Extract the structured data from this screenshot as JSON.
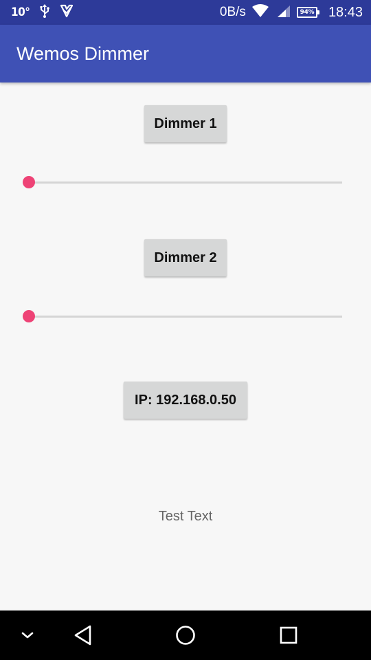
{
  "status_bar": {
    "temperature": "10°",
    "speed": "0B/s",
    "battery": "94%",
    "time": "18:43",
    "icons": [
      "usb-icon",
      "app-notification-icon",
      "wifi-icon",
      "signal-icon",
      "battery-icon"
    ]
  },
  "app_bar": {
    "title": "Wemos Dimmer",
    "color": "#3F51B5"
  },
  "main": {
    "dimmer1_label": "Dimmer 1",
    "slider1_value": 0,
    "dimmer2_label": "Dimmer 2",
    "slider2_value": 0,
    "ip_label": "IP: 192.168.0.50",
    "test_text": "Test Text",
    "accent_color": "#EE4376"
  },
  "nav_bar": {
    "icons": [
      "chevron-down-icon",
      "back-icon",
      "home-icon",
      "recent-apps-icon"
    ]
  }
}
